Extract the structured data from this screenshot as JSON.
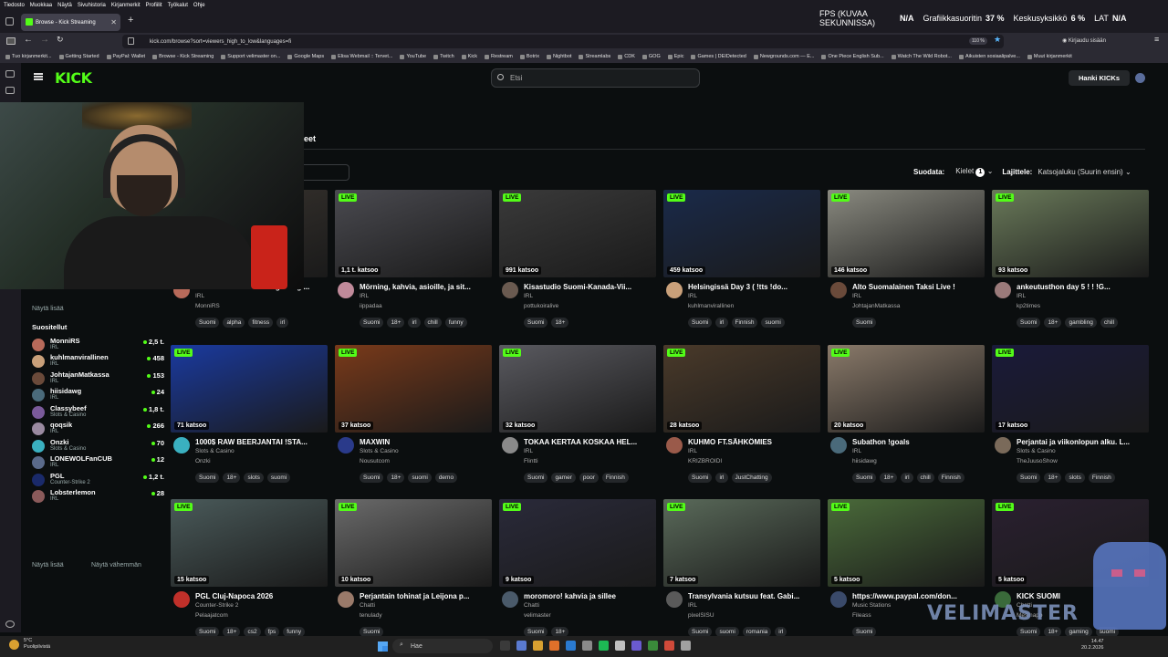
{
  "menu": [
    "Tiedosto",
    "Muokkaa",
    "Näytä",
    "Sivuhistoria",
    "Kirjanmerkit",
    "Profiilit",
    "Työkalut",
    "Ohje"
  ],
  "browser": {
    "tab_title": "Browse - Kick Streaming",
    "url": "kick.com/browse?sort=viewers_high_to_low&languages=fi",
    "zoom": "110 %",
    "signin": "Kirjaudu sisään"
  },
  "overlay": {
    "fps_label": "FPS (KUVAA SEKUNNISSA)",
    "fps_value": "N/A",
    "gpu_label": "Grafiikkasuoritin",
    "gpu_value": "37 %",
    "cpu_label": "Keskusyksikkö",
    "cpu_value": "6 %",
    "lat_label": "LAT",
    "lat_value": "N/A"
  },
  "bookmarks": [
    "Tuo kirjanmerkit...",
    "Getting Started",
    "PayPal: Wallet",
    "Browse - Kick Streaming",
    "Support velimaster on...",
    "Google Maps",
    "Elisa Webmail :: Tervet...",
    "YouTube",
    "Twitch",
    "Kick",
    "Restream",
    "Botrix",
    "Nightbot",
    "Streamlabs",
    "CDK",
    "GOG",
    "Epic",
    "Games | DEIDetected",
    "Newgrounds.com — E...",
    "One Piece English Sub...",
    "Watch The Wild Robot...",
    "Aikuisten sosiaalipalve...",
    "Muut kirjanmerkit"
  ],
  "kick": {
    "logo": "KICK",
    "search_placeholder": "Etsi",
    "get_kicks": "Hanki KICKs",
    "heading": "eet",
    "filter_label": "Suodata:",
    "languages_label": "Kielet",
    "languages_count": "1",
    "sort_label": "Lajittele:",
    "sort_value": "Katsojaluku (Suurin ensin)"
  },
  "sidebar": {
    "show_more_top": "Näytä lisää",
    "recommended": "Suositellut",
    "show_more": "Näytä lisää",
    "show_less": "Näytä vähemmän",
    "items": [
      {
        "name": "MonniRS",
        "cat": "IRL",
        "viewers": "2,5 t.",
        "color": "#b86a5a"
      },
      {
        "name": "kuhlmanvirallinen",
        "cat": "IRL",
        "viewers": "458",
        "color": "#c9a07a"
      },
      {
        "name": "JohtajanMatkassa",
        "cat": "IRL",
        "viewers": "153",
        "color": "#6a4a3a"
      },
      {
        "name": "hiisidawg",
        "cat": "IRL",
        "viewers": "24",
        "color": "#4a6a7a"
      },
      {
        "name": "Classybeef",
        "cat": "Slots & Casino",
        "viewers": "1,8 t.",
        "color": "#7a5a9a"
      },
      {
        "name": "qoqsik",
        "cat": "IRL",
        "viewers": "266",
        "color": "#9a8aa0"
      },
      {
        "name": "Onzki",
        "cat": "Slots & Casino",
        "viewers": "70",
        "color": "#3ab0c0"
      },
      {
        "name": "LONEWOLFanCUB",
        "cat": "IRL",
        "viewers": "12",
        "color": "#5a6a8a"
      },
      {
        "name": "PGL",
        "cat": "Counter-Strike 2",
        "viewers": "1,2 t.",
        "color": "#1a2a6a"
      },
      {
        "name": "Lobsterlemon",
        "cat": "IRL",
        "viewers": "28",
        "color": "#8a5a5a"
      }
    ]
  },
  "live_label": "LIVE",
  "cards": [
    {
      "viewers": "",
      "title": "HELSINKI KAVELU - vegasbogi...",
      "cat": "IRL",
      "name": "MonniRS",
      "tags": [
        "Suomi",
        "alpha",
        "fitness",
        "irl"
      ],
      "bg": "#3a3530",
      "av": "#b86a5a"
    },
    {
      "viewers": "1,1 t. katsoo",
      "title": "Mörning, kahvia, asioille, ja sit...",
      "cat": "IRL",
      "name": "iippadaa",
      "tags": [
        "Suomi",
        "18+",
        "irl",
        "chill",
        "funny"
      ],
      "bg": "#4a4a50",
      "av": "#c08a9a"
    },
    {
      "viewers": "991 katsoo",
      "title": "Kisastudio Suomi-Kanada-Vii...",
      "cat": "IRL",
      "name": "pottukoiralive",
      "tags": [
        "Suomi",
        "18+"
      ],
      "bg": "#3a3a3a",
      "av": "#6a5a50"
    },
    {
      "viewers": "459 katsoo",
      "title": "Helsingissä Day 3 ( !tts !do...",
      "cat": "IRL",
      "name": "kuhlmanvirallinen",
      "tags": [
        "Suomi",
        "irl",
        "Finnish",
        "suomi"
      ],
      "bg": "#1a2a4a",
      "av": "#c9a07a"
    },
    {
      "viewers": "146 katsoo",
      "title": "Alto Suomalainen Taksi Live !",
      "cat": "IRL",
      "name": "JohtajanMatkassa",
      "tags": [
        "Suomi"
      ],
      "bg": "#8a8a80",
      "av": "#6a4a3a"
    },
    {
      "viewers": "93 katsoo",
      "title": "ankeutusthon day 5 ! ! !G...",
      "cat": "IRL",
      "name": "kp2times",
      "tags": [
        "Suomi",
        "18+",
        "gambling",
        "chill"
      ],
      "bg": "#6a7a5a",
      "av": "#9a7a7a"
    },
    {
      "viewers": "71 katsoo",
      "title": "1000$ RAW BEERJANTAI !STA...",
      "cat": "Slots & Casino",
      "name": "Onzki",
      "tags": [
        "Suomi",
        "18+",
        "slots",
        "suomi"
      ],
      "bg": "#1a3aa0",
      "av": "#3ab0c0"
    },
    {
      "viewers": "37 katsoo",
      "title": "MAXWIN",
      "cat": "Slots & Casino",
      "name": "Nousutcom",
      "tags": [
        "Suomi",
        "18+",
        "suomi",
        "demo"
      ],
      "bg": "#7a3a1a",
      "av": "#2a3a8a"
    },
    {
      "viewers": "32 katsoo",
      "title": "TOKAA KERTAA KOSKAA HEL...",
      "cat": "IRL",
      "name": "Flintti",
      "tags": [
        "Suomi",
        "gamer",
        "poor",
        "Finnish"
      ],
      "bg": "#5a5a60",
      "av": "#8a8a8a"
    },
    {
      "viewers": "28 katsoo",
      "title": "KUHMO FT.SÄHKÖMIES",
      "cat": "IRL",
      "name": "KRIZBROIDI",
      "tags": [
        "Suomi",
        "irl",
        "JustChatting"
      ],
      "bg": "#4a3a2a",
      "av": "#9a5a4a"
    },
    {
      "viewers": "20 katsoo",
      "title": "Subathon !goals",
      "cat": "IRL",
      "name": "hiisidawg",
      "tags": [
        "Suomi",
        "18+",
        "irl",
        "chill",
        "Finnish"
      ],
      "bg": "#8a7a6a",
      "av": "#4a6a7a"
    },
    {
      "viewers": "17 katsoo",
      "title": "Perjantai ja viikonlopun alku. L...",
      "cat": "Slots & Casino",
      "name": "TheJuusoShow",
      "tags": [
        "Suomi",
        "18+",
        "slots",
        "Finnish"
      ],
      "bg": "#1a1a3a",
      "av": "#7a6a5a"
    },
    {
      "viewers": "15 katsoo",
      "title": "PGL Cluj-Napoca 2026",
      "cat": "Counter-Strike 2",
      "name": "Pelaajatcom",
      "tags": [
        "Suomi",
        "18+",
        "cs2",
        "fps",
        "funny"
      ],
      "bg": "#4a5a5a",
      "av": "#c0302a"
    },
    {
      "viewers": "10 katsoo",
      "title": "Perjantain tohinat ja Leijona p...",
      "cat": "Chatti",
      "name": "tenulady",
      "tags": [
        "Suomi"
      ],
      "bg": "#6a6a6a",
      "av": "#9a7a6a"
    },
    {
      "viewers": "9 katsoo",
      "title": "moromoro! kahvia ja sillee",
      "cat": "Chatti",
      "name": "velimaster",
      "tags": [
        "Suomi",
        "18+"
      ],
      "bg": "#2a2a3a",
      "av": "#4a5a6a"
    },
    {
      "viewers": "7 katsoo",
      "title": "Transylvania kutsuu feat. Gabi...",
      "cat": "IRL",
      "name": "pixelSISU",
      "tags": [
        "Suomi",
        "suomi",
        "romania",
        "irl"
      ],
      "bg": "#5a6a5a",
      "av": "#5a5a5a"
    },
    {
      "viewers": "5 katsoo",
      "title": "https://www.paypal.com/don...",
      "cat": "Music Stations",
      "name": "Fileass",
      "tags": [
        "Suomi"
      ],
      "bg": "#4a6a3a",
      "av": "#3a4a6a"
    },
    {
      "viewers": "5 katsoo",
      "title": "KICK SUOMI",
      "cat": "Chatti",
      "name": "Mesmapp",
      "tags": [
        "Suomi",
        "18+",
        "gaming",
        "suomi"
      ],
      "bg": "#2a2030",
      "av": "#3a6a3a"
    }
  ],
  "taskbar": {
    "weather_temp": "5°C",
    "weather_desc": "Puolipilvistä",
    "search": "Hae",
    "time": "14.47",
    "date": "20.2.2026"
  },
  "watermark": "VELIMASTER"
}
